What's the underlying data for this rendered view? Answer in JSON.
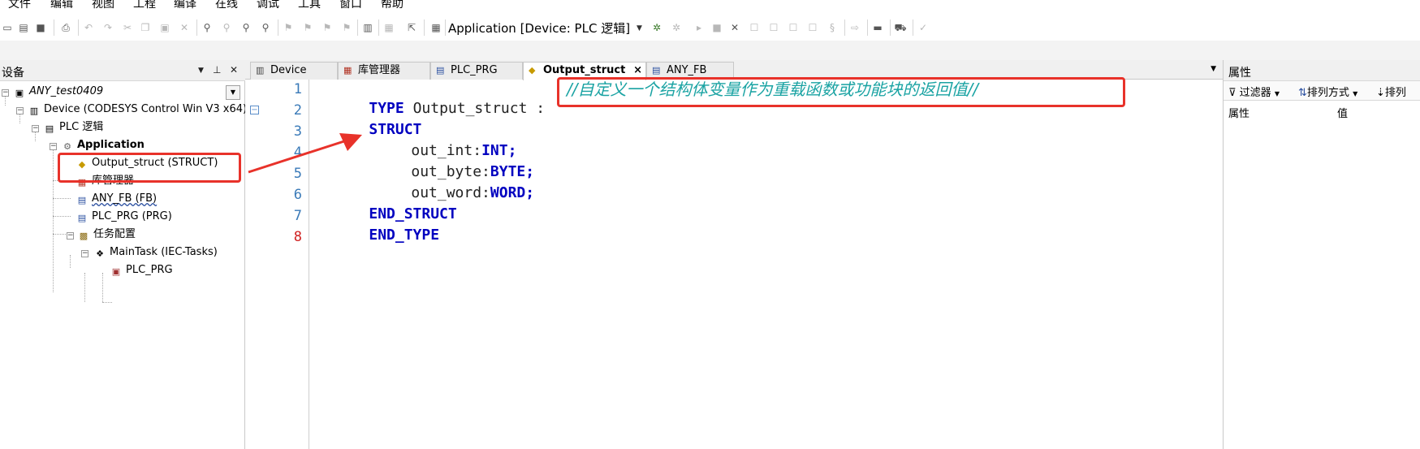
{
  "menu": {
    "items": [
      "文件",
      "编辑",
      "视图",
      "工程",
      "编译",
      "在线",
      "调试",
      "工具",
      "窗口",
      "帮助"
    ]
  },
  "toolbar": {
    "application_combo": "Application [Device: PLC 逻辑]"
  },
  "devices_panel": {
    "title": "设备",
    "pin_icon": "pin-icon",
    "close_icon": "close-icon",
    "tree": [
      {
        "label": "ANY_test0409",
        "icon": "project-icon",
        "italic": true
      },
      {
        "label": "Device (CODESYS Control Win V3 x64)",
        "icon": "device-icon"
      },
      {
        "label": "PLC 逻辑",
        "icon": "plc-logic-icon"
      },
      {
        "label": "Application",
        "icon": "application-gear-icon",
        "bold": true
      },
      {
        "label": "Output_struct (STRUCT)",
        "icon": "dut-icon",
        "highlighted": true
      },
      {
        "label": "库管理器",
        "icon": "library-manager-icon"
      },
      {
        "label": "ANY_FB (FB)",
        "icon": "pou-icon",
        "underlined": true
      },
      {
        "label": "PLC_PRG (PRG)",
        "icon": "pou-icon"
      },
      {
        "label": "任务配置",
        "icon": "task-config-icon"
      },
      {
        "label": "MainTask (IEC-Tasks)",
        "icon": "task-icon"
      },
      {
        "label": "PLC_PRG",
        "icon": "program-call-icon"
      }
    ]
  },
  "editor": {
    "tabs": [
      {
        "label": "Device",
        "icon": "device-icon",
        "active": false
      },
      {
        "label": "库管理器",
        "icon": "library-manager-icon",
        "active": false
      },
      {
        "label": "PLC_PRG",
        "icon": "pou-icon",
        "active": false
      },
      {
        "label": "Output_struct",
        "icon": "dut-icon",
        "active": true,
        "close": "×"
      },
      {
        "label": "ANY_FB",
        "icon": "pou-icon",
        "active": false
      }
    ],
    "line_numbers": [
      "1",
      "2",
      "3",
      "4",
      "5",
      "6",
      "7",
      "8"
    ],
    "code": {
      "l1_kw": "TYPE",
      "l1_id": "Output_struct :",
      "l1_comment": "//自定义一个结构体变量作为重载函数或功能块的返回值//",
      "l2_kw": "STRUCT",
      "l3_id": "out_int:",
      "l3_kw": "INT;",
      "l4_id": "out_byte:",
      "l4_kw": "BYTE;",
      "l5_id": "out_word:",
      "l5_kw": "WORD;",
      "l6_kw": "END_STRUCT",
      "l7_kw": "END_TYPE"
    }
  },
  "properties_panel": {
    "title": "属性",
    "filter_label": "过滤器",
    "sort_label": "排列方式",
    "sort2_label": "排列",
    "col_property": "属性",
    "col_value": "值"
  },
  "colors": {
    "keyword": "#0000c0",
    "comment": "#1aa3a3",
    "annotation": "#e8322a",
    "line_number": "#3a7ab8"
  }
}
